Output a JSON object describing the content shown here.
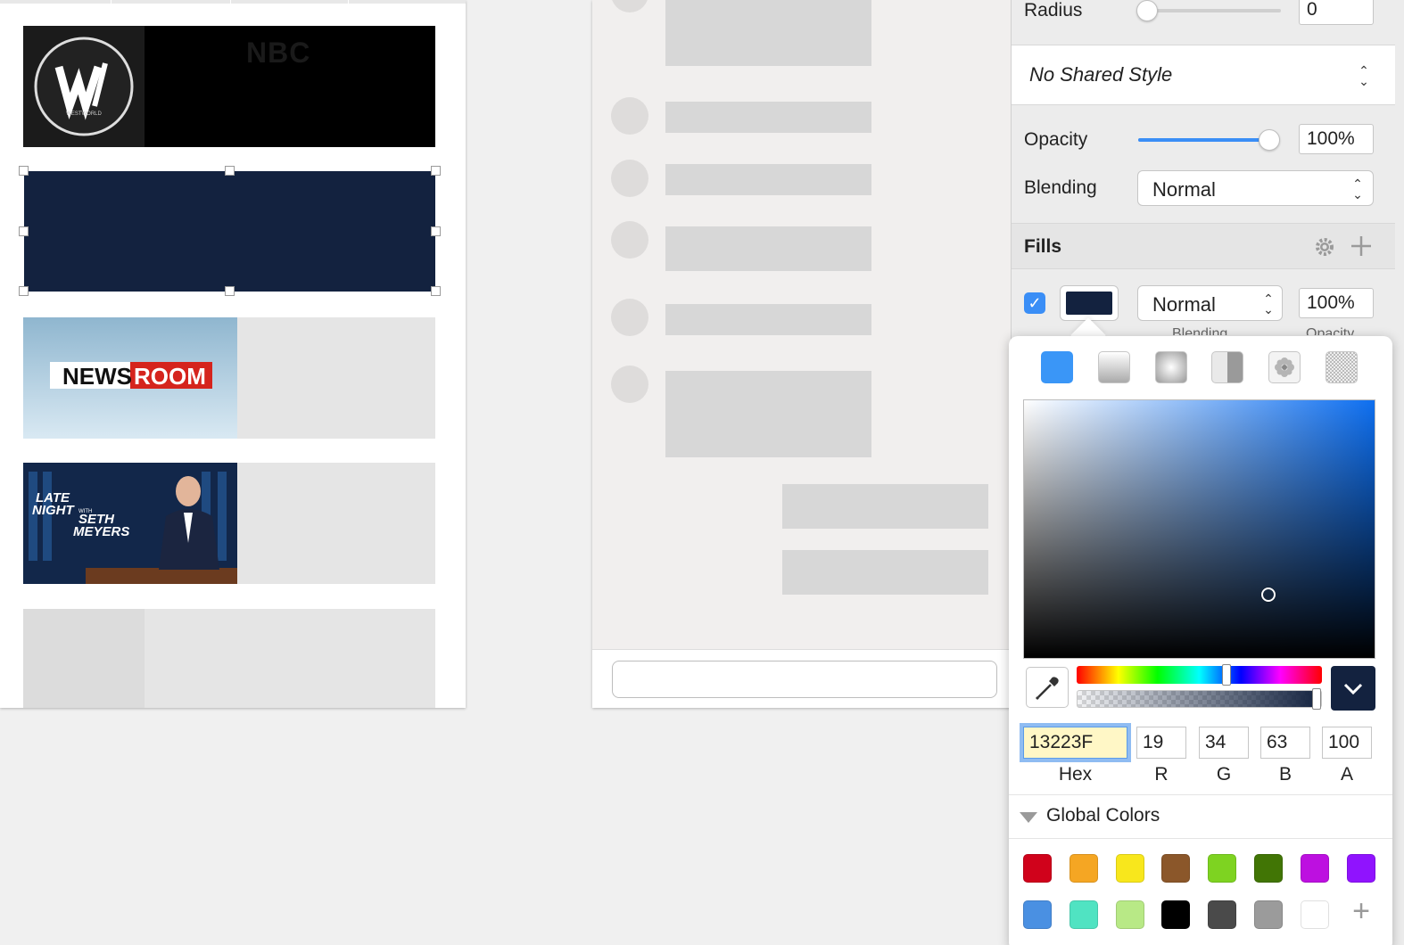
{
  "artboard_left": {
    "cards": [
      {
        "label": "NBC"
      },
      {},
      {},
      {},
      {}
    ],
    "westworld_logo_text": "WESTWORLD",
    "newsroom_logo_text": {
      "part1": "NEWS",
      "part2": "ROOM"
    },
    "latenight_logo_text": {
      "line1": "LATE",
      "line2": "NIGHT",
      "line3": "WITH",
      "line4": "SETH",
      "line5": "MEYERS"
    },
    "selected_fill": "#13223F"
  },
  "inspector": {
    "radius_label": "Radius",
    "radius_value": "0",
    "shared_style": "No Shared Style",
    "opacity_label": "Opacity",
    "opacity_value": "100%",
    "opacity_level": 1.0,
    "blending_label": "Blending",
    "blending_value": "Normal",
    "fills_label": "Fills",
    "fill_blend": "Normal",
    "fill_opacity": "100%",
    "fill_enabled": true,
    "partial_labels": [
      "Blending",
      "Opacity"
    ]
  },
  "color_picker": {
    "hex_value": "13223F",
    "r": "19",
    "g": "34",
    "b": "63",
    "a": "100",
    "labels": {
      "hex": "Hex",
      "r": "R",
      "g": "G",
      "b": "B",
      "a": "A"
    },
    "global_colors_label": "Global Colors",
    "global_colors_row1": [
      "#d0021b",
      "#f5a623",
      "#f8e71c",
      "#8b572a",
      "#7ed321",
      "#417505",
      "#bd10e0",
      "#9013fe"
    ],
    "global_colors_row2": [
      "#4a90e2",
      "#50e3c2",
      "#b8e986",
      "#000000",
      "#4a4a4a",
      "#9b9b9b",
      "#ffffff"
    ],
    "add_color_symbol": "+"
  }
}
